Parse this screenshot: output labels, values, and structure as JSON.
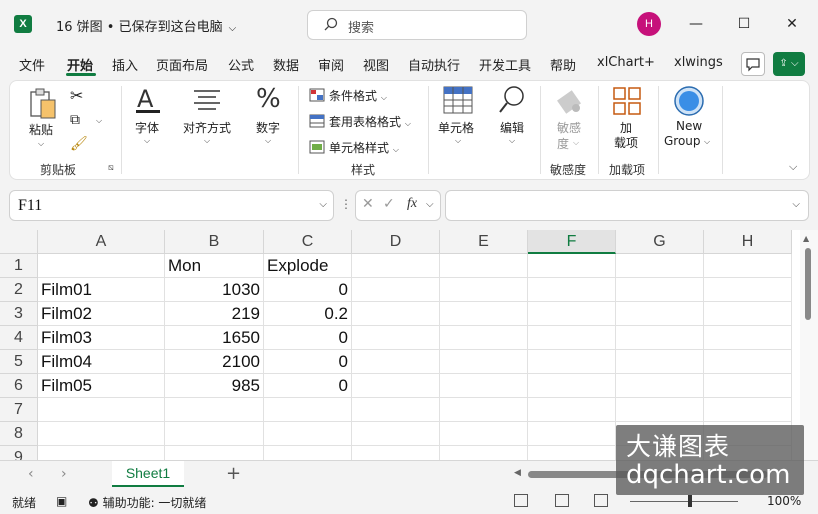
{
  "window": {
    "title": "16 饼图 • 已保存到这台电脑",
    "app_icon": "excel-logo",
    "search_placeholder": "搜索",
    "avatar_initial": "H"
  },
  "menu": {
    "items": [
      "文件",
      "开始",
      "插入",
      "页面布局",
      "公式",
      "数据",
      "审阅",
      "视图",
      "自动执行",
      "开发工具",
      "帮助",
      "xlChart+",
      "xlwings"
    ],
    "active": "开始"
  },
  "ribbon": {
    "paste": "粘贴",
    "clipboard_group": "剪贴板",
    "font": "字体",
    "alignment": "对齐方式",
    "number": "数字",
    "conditional_format": "条件格式",
    "table_format": "套用表格格式",
    "cell_style": "单元格样式",
    "styles_group": "样式",
    "cells": "单元格",
    "editing": "编辑",
    "sensitivity_btn_1": "敏感",
    "sensitivity_btn_2": "度",
    "sensitivity_group": "敏感度",
    "addins_btn_1": "加",
    "addins_btn_2": "载项",
    "addins_group": "加载项",
    "new_group_1": "New",
    "new_group_2": "Group"
  },
  "formula_bar": {
    "name_box": "F11",
    "formula": ""
  },
  "sheet": {
    "columns": [
      "A",
      "B",
      "C",
      "D",
      "E",
      "F",
      "G",
      "H"
    ],
    "selected_column": "F",
    "rows": [
      "1",
      "2",
      "3",
      "4",
      "5",
      "6",
      "7",
      "8",
      "9"
    ],
    "cells": [
      [
        "",
        "Mon",
        "Explode"
      ],
      [
        "Film01",
        "1030",
        "0"
      ],
      [
        "Film02",
        "219",
        "0.2"
      ],
      [
        "Film03",
        "1650",
        "0"
      ],
      [
        "Film04",
        "2100",
        "0"
      ],
      [
        "Film05",
        "985",
        "0"
      ]
    ],
    "tab_name": "Sheet1"
  },
  "status": {
    "ready": "就绪",
    "accessibility": "辅助功能: 一切就绪",
    "zoom": "100%"
  },
  "watermark": {
    "line1": "大谦图表",
    "line2": "dqchart.com"
  }
}
